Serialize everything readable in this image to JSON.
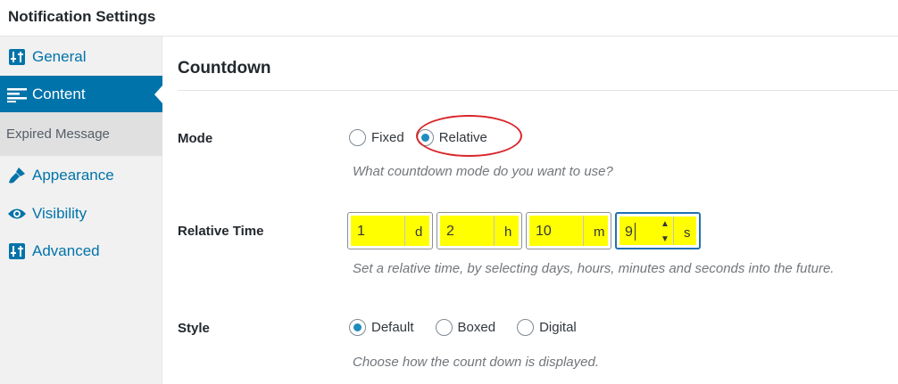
{
  "header": {
    "title": "Notification Settings"
  },
  "sidebar": {
    "items": [
      {
        "label": "General",
        "icon": "sliders-icon"
      },
      {
        "label": "Content",
        "icon": "content-align-icon",
        "active": true
      },
      {
        "label": "Expired Message",
        "submenu": true
      },
      {
        "label": "Appearance",
        "icon": "paintbrush-icon"
      },
      {
        "label": "Visibility",
        "icon": "eye-icon"
      },
      {
        "label": "Advanced",
        "icon": "sliders-icon"
      }
    ]
  },
  "main": {
    "section_title": "Countdown",
    "mode": {
      "label": "Mode",
      "options": [
        "Fixed",
        "Relative"
      ],
      "selected": "Relative",
      "help": "What countdown mode do you want to use?"
    },
    "relative_time": {
      "label": "Relative Time",
      "fields": [
        {
          "value": "1",
          "unit": "d"
        },
        {
          "value": "2",
          "unit": "h"
        },
        {
          "value": "10",
          "unit": "m"
        },
        {
          "value": "9",
          "unit": "s"
        }
      ],
      "help": "Set a relative time, by selecting days, hours, minutes and seconds into the future."
    },
    "style": {
      "label": "Style",
      "options": [
        "Default",
        "Boxed",
        "Digital"
      ],
      "selected": "Default",
      "help": "Choose how the count down is displayed."
    }
  },
  "colors": {
    "accent": "#0073aa",
    "highlight": "#ffff00",
    "annotation": "#d9262a"
  }
}
